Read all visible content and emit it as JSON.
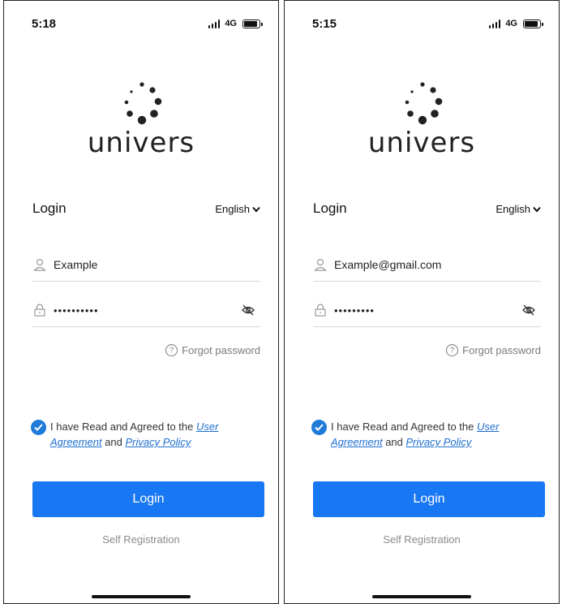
{
  "screens": [
    {
      "status": {
        "time": "5:18",
        "network": "4G"
      },
      "logo_text": "univers",
      "heading": "Login",
      "language": "English",
      "username_value": "Example",
      "password_mask": "••••••••••",
      "forgot_label": "Forgot password",
      "agree_prefix": "I have Read and Agreed to the ",
      "user_agreement_link": "User Agreement",
      "agree_and": " and ",
      "privacy_link": "Privacy Policy",
      "login_button": "Login",
      "self_registration": "Self Registration"
    },
    {
      "status": {
        "time": "5:15",
        "network": "4G"
      },
      "logo_text": "univers",
      "heading": "Login",
      "language": "English",
      "username_value": "Example@gmail.com",
      "password_mask": "•••••••••",
      "forgot_label": "Forgot password",
      "agree_prefix": "I have Read and Agreed to the ",
      "user_agreement_link": "User Agreement",
      "agree_and": " and ",
      "privacy_link": "Privacy Policy",
      "login_button": "Login",
      "self_registration": "Self Registration"
    }
  ],
  "colors": {
    "primary_button": "#1877f2",
    "link": "#1e6fd1",
    "checkbox": "#1e7bd8",
    "muted_text": "#8a8a8a"
  },
  "icons": [
    "signal-icon",
    "battery-icon",
    "user-icon",
    "lock-icon",
    "eye-off-icon",
    "help-icon",
    "check-icon",
    "chevron-down-icon"
  ]
}
